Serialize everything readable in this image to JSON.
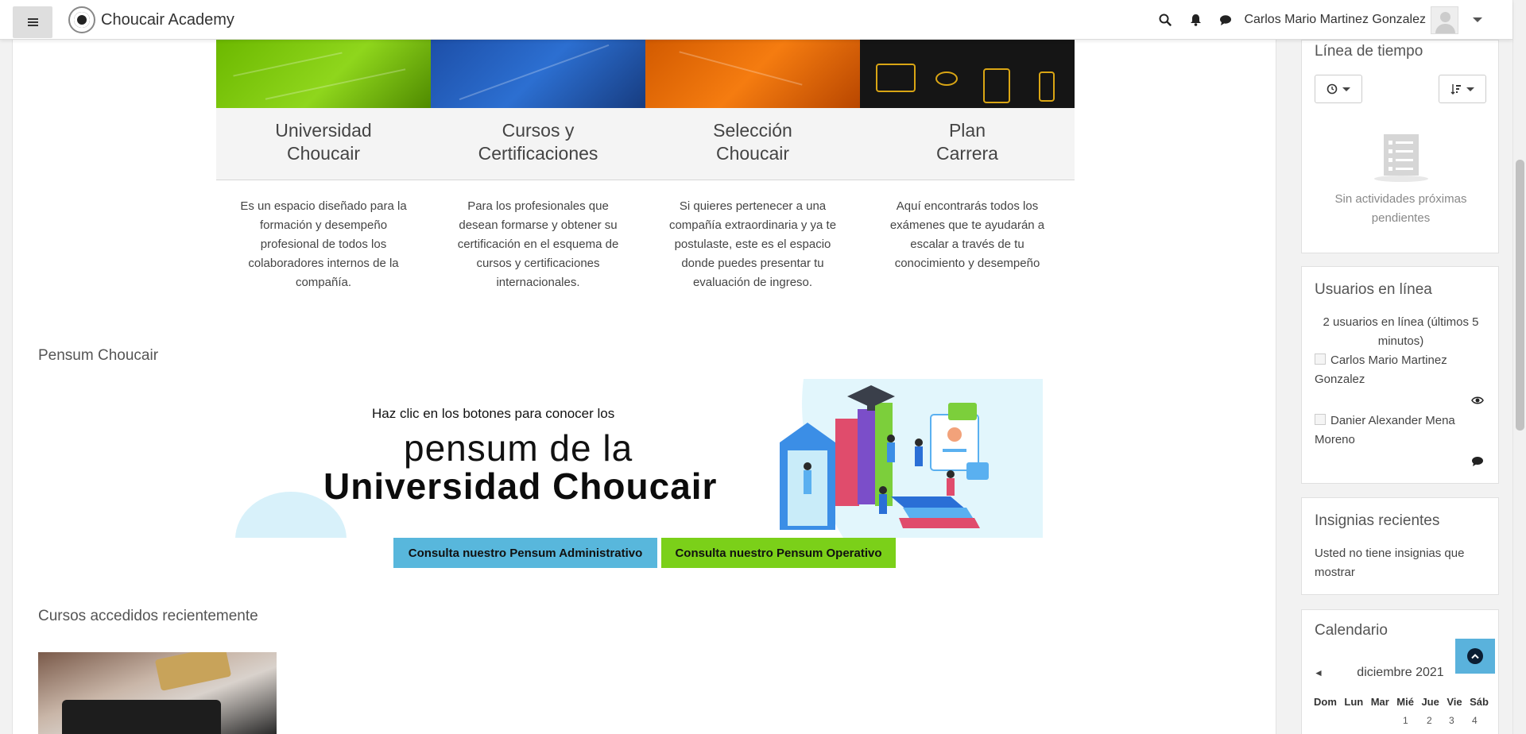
{
  "navbar": {
    "site_name": "Choucair Academy",
    "user_name": "Carlos Mario Martinez Gonzalez"
  },
  "cards": [
    {
      "title_line1": "Universidad",
      "title_line2": "Choucair",
      "description": "Es un espacio diseñado para la formación y desempeño profesional de todos los colaboradores internos de la compañía."
    },
    {
      "title_line1": "Cursos y",
      "title_line2": "Certificaciones",
      "description": "Para los profesionales que desean formarse y obtener su certificación en el esquema de cursos y certificaciones internacionales."
    },
    {
      "title_line1": "Selección",
      "title_line2": "Choucair",
      "description": "Si quieres pertenecer a una compañía extraordinaria y ya te postulaste, este es el espacio donde puedes presentar tu evaluación de ingreso."
    },
    {
      "title_line1": "Plan",
      "title_line2": "Carrera",
      "description": "Aquí encontrarás todos los exámenes que te ayudarán a escalar a través de tu conocimiento y desempeño"
    }
  ],
  "pensum": {
    "section_title": "Pensum Choucair",
    "banner_line1": "Haz clic en los botones para conocer los",
    "banner_line2": "pensum de la",
    "banner_line3": "Universidad Choucair",
    "btn_admin": "Consulta nuestro Pensum Administrativo",
    "btn_oper": "Consulta nuestro Pensum Operativo"
  },
  "recent": {
    "section_title": "Cursos accedidos recientemente"
  },
  "timeline": {
    "title": "Línea de tiempo",
    "empty": "Sin actividades próximas pendientes"
  },
  "online": {
    "title": "Usuarios en línea",
    "summary": "2 usuarios en línea (últimos 5 minutos)",
    "users": [
      "Carlos Mario Martinez Gonzalez",
      "Danier Alexander Mena Moreno"
    ]
  },
  "badges": {
    "title": "Insignias recientes",
    "empty": "Usted no tiene insignias que mostrar"
  },
  "calendar": {
    "title": "Calendario",
    "month": "diciembre 2021",
    "prev_arrow": "◄",
    "days": [
      "Dom",
      "Lun",
      "Mar",
      "Mié",
      "Jue",
      "Vie",
      "Sáb"
    ],
    "visible_dates": [
      "1",
      "2",
      "3",
      "4"
    ]
  },
  "colors": {
    "accent_blue": "#58b7dc",
    "accent_green": "#7bd019"
  }
}
